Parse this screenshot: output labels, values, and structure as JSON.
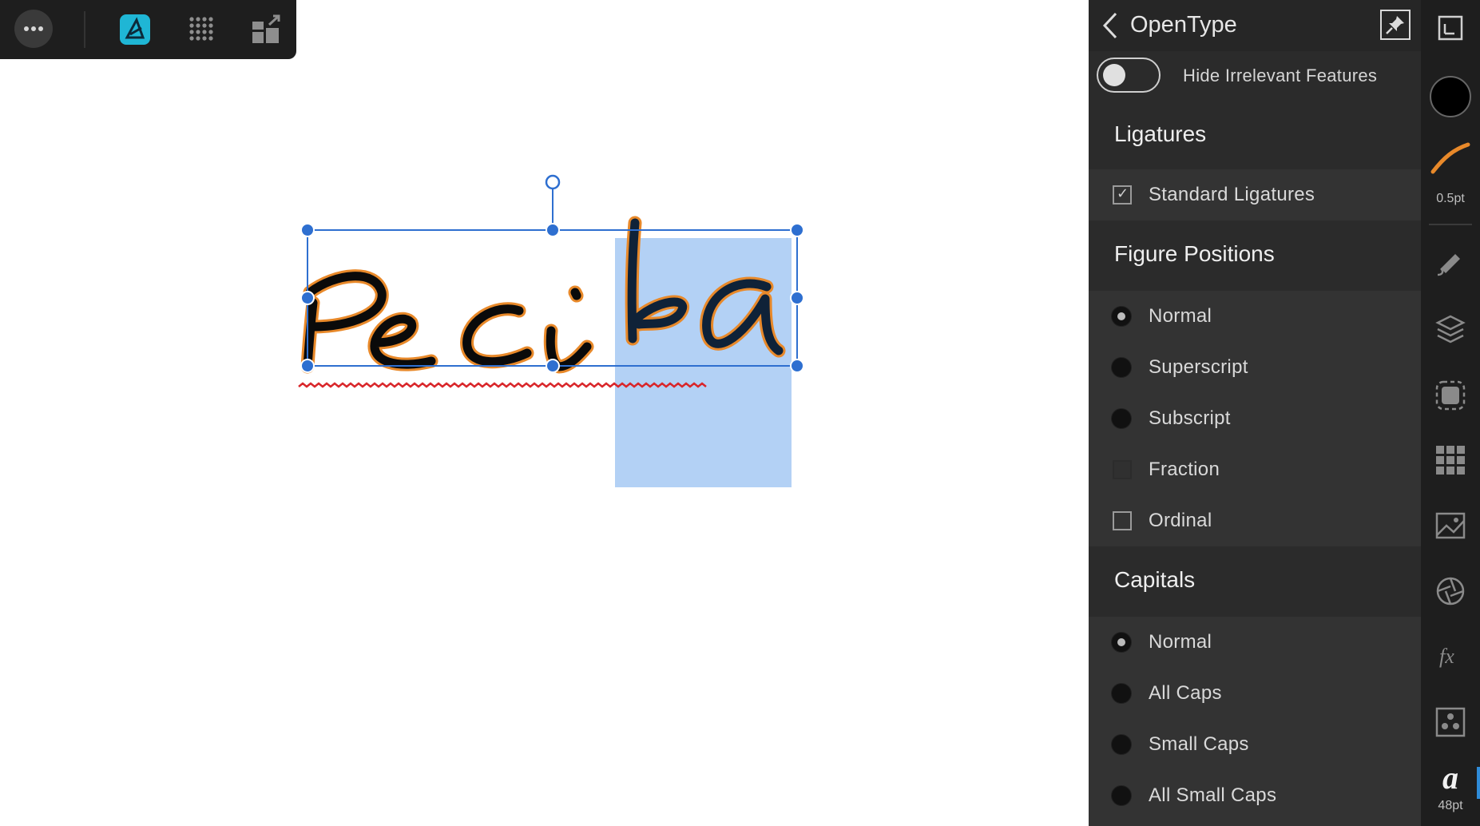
{
  "panel": {
    "title": "OpenType",
    "hide_irrelevant_label": "Hide Irrelevant Features",
    "sections": {
      "ligatures": {
        "title": "Ligatures",
        "standard_ligatures": "Standard Ligatures"
      },
      "figure_positions": {
        "title": "Figure Positions",
        "normal": "Normal",
        "superscript": "Superscript",
        "subscript": "Subscript",
        "fraction": "Fraction",
        "ordinal": "Ordinal"
      },
      "capitals": {
        "title": "Capitals",
        "normal": "Normal",
        "all_caps": "All Caps",
        "small_caps": "Small Caps",
        "all_small_caps": "All Small Caps"
      }
    }
  },
  "strip": {
    "stroke_width": "0.5pt",
    "font_size": "48pt",
    "font_glyph": "a"
  },
  "colors": {
    "accent": "#2e6fd0",
    "selection": "#b3d1f5",
    "stroke_orange": "#e8892a",
    "spell_underline": "#d9262a"
  }
}
